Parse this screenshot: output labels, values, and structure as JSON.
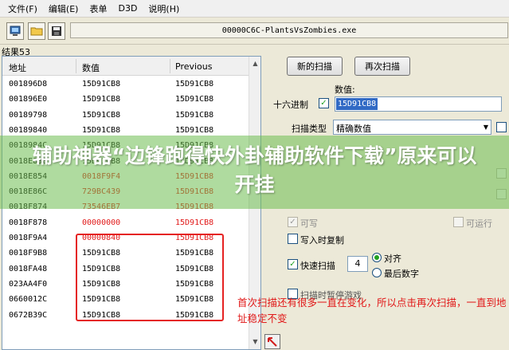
{
  "menu": [
    "文件(F)",
    "编辑(E)",
    "表单",
    "D3D",
    "说明(H)"
  ],
  "process": "00000C6C-PlantsVsZombies.exe",
  "results": {
    "label": "结果53"
  },
  "table": {
    "headers": [
      "地址",
      "数值",
      "Previous"
    ],
    "rows": [
      [
        "001896D8",
        "15D91CB8",
        "15D91CB8"
      ],
      [
        "001896E0",
        "15D91CB8",
        "15D91CB8"
      ],
      [
        "00189798",
        "15D91CB8",
        "15D91CB8"
      ],
      [
        "00189840",
        "15D91CB8",
        "15D91CB8"
      ],
      [
        "0018984C",
        "15D91CB8",
        "15D91CB8"
      ],
      [
        "0018E830",
        "15D91CB8",
        "15D91CB8"
      ],
      [
        "0018E854",
        "0018F9F4",
        "15D91CB8"
      ],
      [
        "0018E86C",
        "729BC439",
        "15D91CB8"
      ],
      [
        "0018F874",
        "73546EB7",
        "15D91CB8"
      ],
      [
        "0018F878",
        "00000000",
        "15D91CB8"
      ],
      [
        "0018F9A4",
        "00000840",
        "15D91CB8"
      ],
      [
        "0018F9B8",
        "15D91CB8",
        "15D91CB8"
      ],
      [
        "0018FA48",
        "15D91CB8",
        "15D91CB8"
      ],
      [
        "023AA4F0",
        "15D91CB8",
        "15D91CB8"
      ],
      [
        "0660012C",
        "15D91CB8",
        "15D91CB8"
      ],
      [
        "0672B39C",
        "15D91CB8",
        "15D91CB8"
      ]
    ],
    "changed_rows": [
      6,
      7,
      8,
      9,
      10
    ]
  },
  "panel": {
    "new_scan": "新的扫描",
    "next_scan": "再次扫描",
    "value_label": "数值:",
    "hex_label": "十六进制",
    "hex_checked": "✓",
    "value": "15D91CB8",
    "scan_type_label": "扫描类型",
    "scan_type": "精确数值",
    "writable": "可写",
    "executable": "可运行",
    "copy_on_write": "写入时复制",
    "fast_scan": "快速扫描",
    "fast_scan_value": "4",
    "align": "对齐",
    "last_digit": "最后数字",
    "pause_hint": "扫描时暂停游戏"
  },
  "banner": "辅助神器“边锋跑得快外卦辅助软件下载”原来可以开挂",
  "annotation": "首次扫描还有很多一直在变化，所以点击再次扫描，一直到地址稳定不变",
  "colors": {
    "changed": "#e11919",
    "banner": "#6ebe50",
    "selection": "#316ac5"
  }
}
